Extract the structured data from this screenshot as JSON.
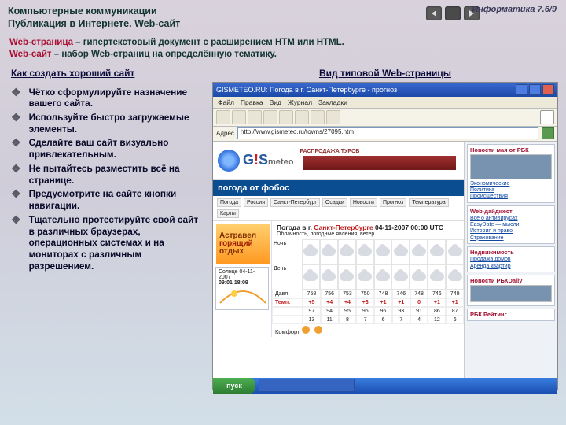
{
  "header": {
    "line1": "Компьютерные коммуникации",
    "line2": "Публикация в Интернете. Web-сайт",
    "corner": "Информатика   7.6/9"
  },
  "definitions": {
    "term1": "Web-страница",
    "rest1": " – гипертекстовый документ с расширением HTM или HTML.",
    "term2": "Web-сайт",
    "rest2": " – набор Web-страниц на определённую тематику."
  },
  "left": {
    "title": "Как создать хороший сайт",
    "tips": [
      "Чётко сформулируйте назначение вашего сайта.",
      "Используйте быстро загружаемые элементы.",
      "Сделайте ваш сайт визуально привлекательным.",
      "Не пытайтесь разместить всё на странице.",
      "Предусмотрите на сайте кнопки навигации.",
      "Тщательно протестируйте свой сайт в различных браузерах, операционных системах и на мониторах с различным разрешением."
    ]
  },
  "right": {
    "title": "Вид типовой Web-страницы",
    "browser": {
      "title": "GISMETEO.RU: Погода в г. Санкт-Петербурге - прогноз",
      "menu": [
        "Файл",
        "Правка",
        "Вид",
        "Журнал",
        "Закладки"
      ],
      "addr_label": "Адрес",
      "url": "http://www.gismeteo.ru/towns/27095.htm"
    },
    "page": {
      "brand_a": "G",
      "brand_b": "!",
      "brand_c": "S",
      "brand_sub": "meteo",
      "ad_caption": "РАСПРОДАЖА ТУРОВ",
      "strip": "погода от фобос",
      "tabs": [
        "Погода",
        "Россия",
        "Санкт-Петербург",
        "Осадки",
        "Новости",
        "Прогноз",
        "Температура",
        "Карты"
      ],
      "head2_a": "Погода в г. ",
      "head2_b": "Санкт-Петербурге",
      "head2_c": "  04-11-2007 00:00 UTC",
      "sub2": "Облачность, погодные явления, ветер",
      "row_lab1": "Ночь",
      "row_lab2": "День",
      "trow_p": [
        "Давл.",
        "758",
        "756",
        "753",
        "750",
        "748",
        "746",
        "748",
        "746",
        "749"
      ],
      "trow_t": [
        "Темп.",
        "+5",
        "+4",
        "+4",
        "+3",
        "+1",
        "+1",
        "0",
        "+1",
        "+1"
      ],
      "trow_h": [
        "",
        "97",
        "94",
        "95",
        "96",
        "96",
        "93",
        "91",
        "86",
        "87"
      ],
      "trow_w": [
        "",
        "13",
        "11",
        "8",
        "7",
        "6",
        "7",
        "4",
        "12",
        "6"
      ],
      "promo_a": "Астравел",
      "promo_b": "горящий",
      "promo_c": "отдых",
      "chart_lab": "Солнце  04-11-2007",
      "chart_a": "09:01",
      "chart_b": "18:09",
      "k_lab": "Комфорт",
      "side": {
        "b1": "Новости мая от РБК",
        "b1l1": "Экономические",
        "b1l2": "Политика",
        "b1l3": "Происшествия",
        "b2": "Web-дайджест",
        "b2l1": "Все о антивирусах",
        "b2l2": "EasyDate — мысли",
        "b2l3": "История и право",
        "b2l4": "Страхование",
        "b3": "Недвижимость",
        "b3l1": "Продажа домов",
        "b3l2": "Аренда квартир",
        "b4": "Новости РБКDaily",
        "b5": "РБК.Рейтинг"
      }
    },
    "taskbar": {
      "start": "пуск"
    }
  }
}
